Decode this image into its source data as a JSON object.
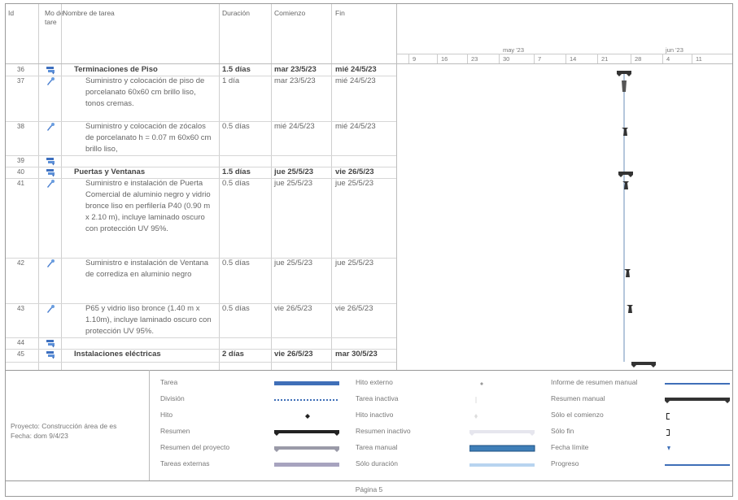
{
  "headers": {
    "id": "Id",
    "mode": "Mo de tare",
    "name": "Nombre de tarea",
    "duration": "Duración",
    "start": "Comienzo",
    "finish": "Fin"
  },
  "timeline": {
    "months": [
      {
        "label": "may '23"
      },
      {
        "label": "jun '23"
      }
    ],
    "days": [
      "9",
      "16",
      "23",
      "30",
      "7",
      "14",
      "21",
      "28",
      "4",
      "11"
    ]
  },
  "rows": [
    {
      "id": "36",
      "name": "Terminaciones de Piso",
      "duration": "1.5 días",
      "start": "mar 23/5/23",
      "finish": "mié 24/5/23",
      "summary": true,
      "icon": "auto-schedule-icon"
    },
    {
      "id": "37",
      "name": "Suministro y colocación de piso de porcelanato 60x60 cm brillo liso, tonos cremas.",
      "duration": "1 día",
      "start": "mar 23/5/23",
      "finish": "mié 24/5/23",
      "summary": false,
      "icon": "manual-schedule-icon"
    },
    {
      "id": "38",
      "name": "Suministro y colocación de zócalos de porcelanato h = 0.07 m 60x60 cm brillo liso,",
      "duration": "0.5 días",
      "start": "mié 24/5/23",
      "finish": "mié 24/5/23",
      "summary": false,
      "icon": "manual-schedule-icon"
    },
    {
      "id": "39",
      "name": "",
      "duration": "",
      "start": "",
      "finish": "",
      "summary": false,
      "icon": "auto-schedule-icon"
    },
    {
      "id": "40",
      "name": "Puertas y Ventanas",
      "duration": "1.5 días",
      "start": "jue 25/5/23",
      "finish": "vie 26/5/23",
      "summary": true,
      "icon": "auto-schedule-icon"
    },
    {
      "id": "41",
      "name": "Suministro e instalación de Puerta Comercial de aluminio negro y vidrio bronce liso en perfilería P40 (0.90 m x 2.10 m), incluye laminado oscuro con protección UV 95%.",
      "duration": "0.5 días",
      "start": "jue 25/5/23",
      "finish": "jue 25/5/23",
      "summary": false,
      "icon": "manual-schedule-icon"
    },
    {
      "id": "42",
      "name": "Suministro e instalación de Ventana de corrediza en aluminio negro",
      "duration": "0.5 días",
      "start": "jue 25/5/23",
      "finish": "jue 25/5/23",
      "summary": false,
      "icon": "manual-schedule-icon"
    },
    {
      "id": "43",
      "name": "P65 y vidrio liso bronce (1.40 m x 1.10m), incluye laminado oscuro con protección UV 95%.",
      "duration": "0.5 días",
      "start": "vie 26/5/23",
      "finish": "vie 26/5/23",
      "summary": false,
      "icon": "manual-schedule-icon"
    },
    {
      "id": "44",
      "name": "",
      "duration": "",
      "start": "",
      "finish": "",
      "summary": false,
      "icon": "auto-schedule-icon"
    },
    {
      "id": "45",
      "name": "Instalaciones eléctricas",
      "duration": "2 días",
      "start": "vie 26/5/23",
      "finish": "mar 30/5/23",
      "summary": true,
      "icon": "auto-schedule-icon"
    }
  ],
  "project": {
    "line1": "Proyecto: Construcción área de es",
    "line2": "Fecha: dom 9/4/23"
  },
  "legend": {
    "col1": [
      "Tarea",
      "División",
      "Hito",
      "Resumen",
      "Resumen del proyecto",
      "Tareas externas"
    ],
    "col2": [
      "Hito externo",
      "Tarea inactiva",
      "Hito inactivo",
      "Resumen inactivo",
      "Tarea manual",
      "Sólo duración"
    ],
    "col3": [
      "Informe de resumen manual",
      "Resumen manual",
      "Sólo el comienzo",
      "Sólo fin",
      "Fecha límite",
      "Progreso"
    ]
  },
  "footer": {
    "page": "Página 5"
  },
  "colors": {
    "task": "#3f6fb8",
    "summary": "#333333",
    "grid": "#cfcfcf"
  }
}
